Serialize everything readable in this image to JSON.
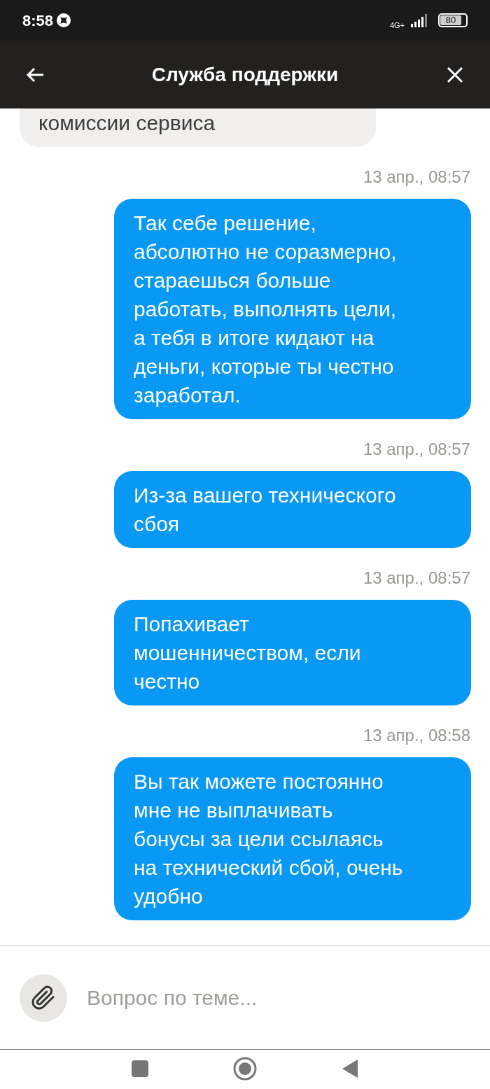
{
  "status_bar": {
    "time": "8:58",
    "network": "4G+",
    "battery": "80"
  },
  "header": {
    "title": "Служба поддержки"
  },
  "messages": [
    {
      "kind": "incoming",
      "text": "комиссии сервиса"
    },
    {
      "kind": "outgoing",
      "time": "13 апр., 08:57",
      "text": "Так себе решение,\nабсолютно не соразмерно,\nстараешься больше\nработать, выполнять цели,\nа тебя в итоге кидают на\nденьги, которые ты честно\nзаработал."
    },
    {
      "kind": "outgoing",
      "time": "13 апр., 08:57",
      "text": "Из-за вашего технического\nсбоя"
    },
    {
      "kind": "outgoing",
      "time": "13 апр., 08:57",
      "text": "Попахивает\nмошенничеством, если\nчестно"
    },
    {
      "kind": "outgoing",
      "time": "13 апр., 08:58",
      "text": "Вы так можете постоянно\nмне не выплачивать\nбонусы за цели ссылаясь\nна технический сбой, очень\nудобно"
    }
  ],
  "composer": {
    "placeholder": "Вопрос по теме..."
  }
}
